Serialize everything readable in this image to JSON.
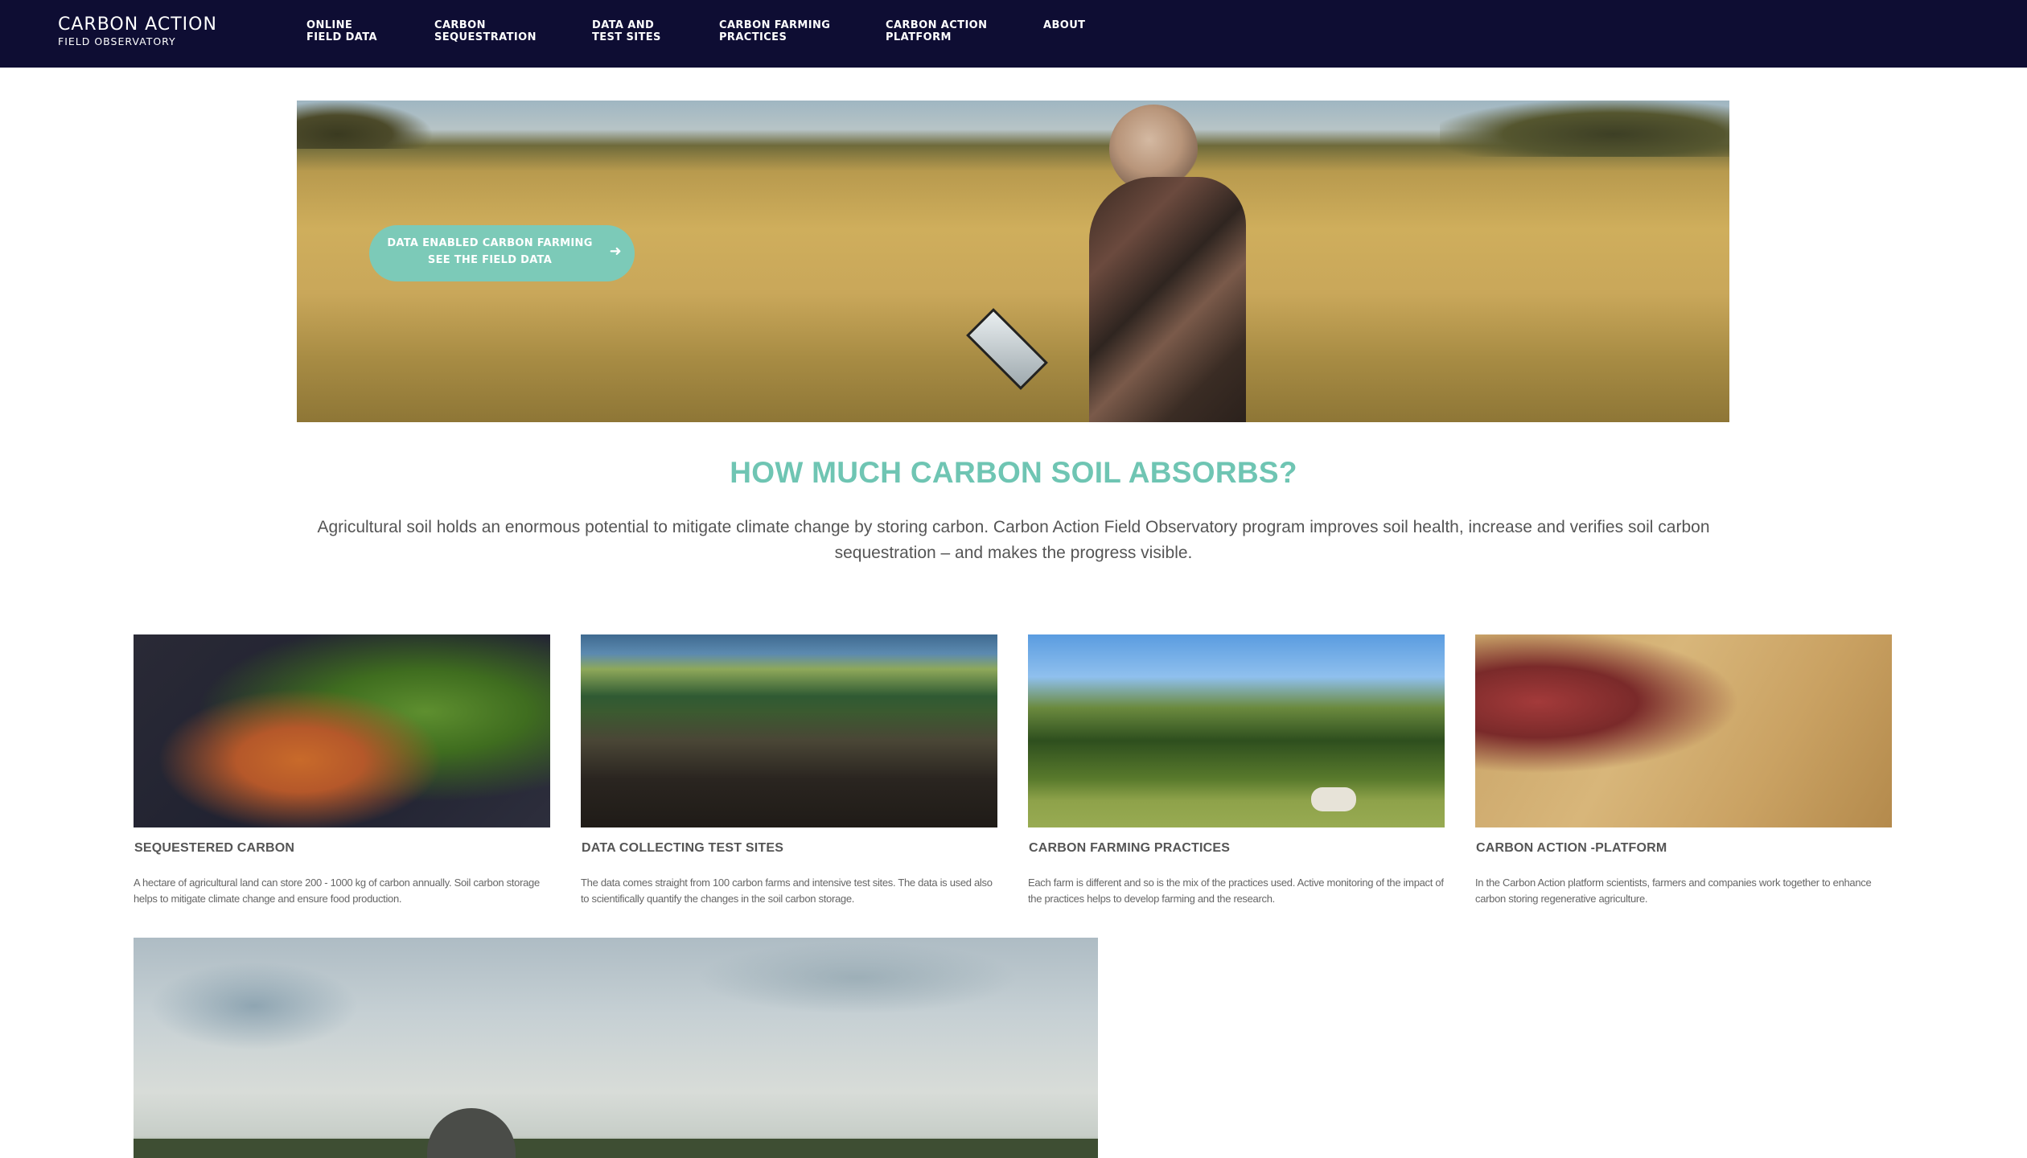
{
  "brand": {
    "title": "CARBON ACTION",
    "subtitle": "FIELD OBSERVATORY"
  },
  "nav": [
    {
      "line1": "ONLINE",
      "line2": "FIELD DATA"
    },
    {
      "line1": "CARBON",
      "line2": "SEQUESTRATION"
    },
    {
      "line1": "DATA AND",
      "line2": "TEST SITES"
    },
    {
      "line1": "CARBON FARMING",
      "line2": "PRACTICES"
    },
    {
      "line1": "CARBON ACTION",
      "line2": "PLATFORM"
    },
    {
      "line1": "ABOUT",
      "line2": ""
    }
  ],
  "hero": {
    "cta_line1": "DATA ENABLED CARBON FARMING",
    "cta_line2": "SEE THE FIELD DATA",
    "cta_icon": "arrow-right-icon"
  },
  "main": {
    "heading": "HOW MUCH CARBON SOIL ABSORBS?",
    "intro": "Agricultural soil holds an enormous potential to mitigate climate change by storing carbon. Carbon Action Field Observatory program improves soil health, increase and verifies soil carbon sequestration – and makes the progress visible."
  },
  "cards": [
    {
      "title": "SEQUESTERED CARBON",
      "desc": "A hectare of agricultural land can store 200 - 1000 kg of carbon annually. Soil carbon storage helps to mitigate climate change and ensure food production."
    },
    {
      "title": "DATA COLLECTING TEST SITES",
      "desc": "The data comes straight from 100 carbon farms and intensive test sites. The data is used also to scientifically quantify the changes in the soil carbon storage."
    },
    {
      "title": "CARBON FARMING PRACTICES",
      "desc": "Each farm is different and so is the mix of the practices used. Active monitoring of the impact of the practices helps to develop farming and the research."
    },
    {
      "title": "CARBON ACTION -PLATFORM",
      "desc": "In the Carbon Action platform scientists, farmers and companies work together to enhance carbon storing regenerative agriculture."
    }
  ],
  "colors": {
    "nav_bg": "#0e0d33",
    "accent": "#6fc5b3",
    "cta_bg": "#7ccab8"
  }
}
